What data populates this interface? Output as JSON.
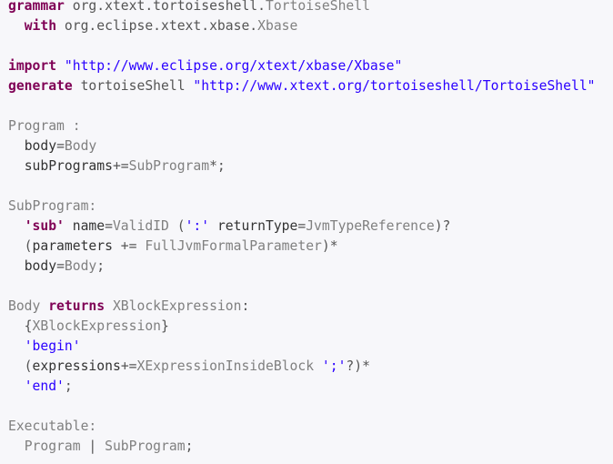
{
  "document": {
    "language": "Xtext grammar",
    "colors": {
      "keyword": "#7f0055",
      "string": "#2a00ff",
      "identifier": "#333333",
      "reference": "#808080",
      "background": "#f7f7fa"
    },
    "lines": [
      [
        [
          "kw",
          "grammar"
        ],
        [
          "plain",
          " org.xtext.tortoiseshell."
        ],
        [
          "ref",
          "TortoiseShell"
        ]
      ],
      [
        [
          "plain",
          "  "
        ],
        [
          "kw",
          "with"
        ],
        [
          "plain",
          " org.eclipse.xtext.xbase."
        ],
        [
          "ref",
          "Xbase"
        ]
      ],
      [],
      [
        [
          "kw",
          "import"
        ],
        [
          "plain",
          " "
        ],
        [
          "str",
          "\"http://www.eclipse.org/xtext/xbase/Xbase\""
        ]
      ],
      [
        [
          "kw",
          "generate"
        ],
        [
          "plain",
          " tortoiseShell "
        ],
        [
          "str",
          "\"http://www.xtext.org/tortoiseshell/TortoiseShell\""
        ]
      ],
      [],
      [
        [
          "ref",
          "Program :"
        ]
      ],
      [
        [
          "plain",
          "  "
        ],
        [
          "id",
          "body"
        ],
        [
          "plain",
          "="
        ],
        [
          "ref",
          "Body"
        ]
      ],
      [
        [
          "plain",
          "  "
        ],
        [
          "id",
          "subPrograms"
        ],
        [
          "plain",
          "+="
        ],
        [
          "ref",
          "SubProgram"
        ],
        [
          "plain",
          "*;"
        ]
      ],
      [],
      [
        [
          "ref",
          "SubProgram:"
        ]
      ],
      [
        [
          "plain",
          "  "
        ],
        [
          "kw",
          "'sub'"
        ],
        [
          "plain",
          " "
        ],
        [
          "id",
          "name"
        ],
        [
          "plain",
          "="
        ],
        [
          "ref",
          "ValidID"
        ],
        [
          "plain",
          " ("
        ],
        [
          "str",
          "':'"
        ],
        [
          "plain",
          " "
        ],
        [
          "id",
          "returnType"
        ],
        [
          "plain",
          "="
        ],
        [
          "ref",
          "JvmTypeReference"
        ],
        [
          "plain",
          ")?"
        ]
      ],
      [
        [
          "plain",
          "  ("
        ],
        [
          "id",
          "parameters"
        ],
        [
          "plain",
          " += "
        ],
        [
          "ref",
          "FullJvmFormalParameter"
        ],
        [
          "plain",
          ")*"
        ]
      ],
      [
        [
          "plain",
          "  "
        ],
        [
          "id",
          "body"
        ],
        [
          "plain",
          "="
        ],
        [
          "ref",
          "Body"
        ],
        [
          "plain",
          ";"
        ]
      ],
      [],
      [
        [
          "ref",
          "Body "
        ],
        [
          "kw",
          "returns"
        ],
        [
          "plain",
          " "
        ],
        [
          "ref",
          "XBlockExpression"
        ],
        [
          "plain",
          ":"
        ]
      ],
      [
        [
          "plain",
          "  {"
        ],
        [
          "ref",
          "XBlockExpression"
        ],
        [
          "plain",
          "}"
        ]
      ],
      [
        [
          "plain",
          "  "
        ],
        [
          "str",
          "'begin'"
        ]
      ],
      [
        [
          "plain",
          "  ("
        ],
        [
          "id",
          "expressions"
        ],
        [
          "plain",
          "+="
        ],
        [
          "ref",
          "XExpressionInsideBlock"
        ],
        [
          "plain",
          " "
        ],
        [
          "str",
          "';'"
        ],
        [
          "plain",
          "?)*"
        ]
      ],
      [
        [
          "plain",
          "  "
        ],
        [
          "str",
          "'end'"
        ],
        [
          "plain",
          ";"
        ]
      ],
      [],
      [
        [
          "ref",
          "Executable:"
        ]
      ],
      [
        [
          "plain",
          "  "
        ],
        [
          "ref",
          "Program"
        ],
        [
          "plain",
          " | "
        ],
        [
          "ref",
          "SubProgram"
        ],
        [
          "plain",
          ";"
        ]
      ]
    ]
  }
}
